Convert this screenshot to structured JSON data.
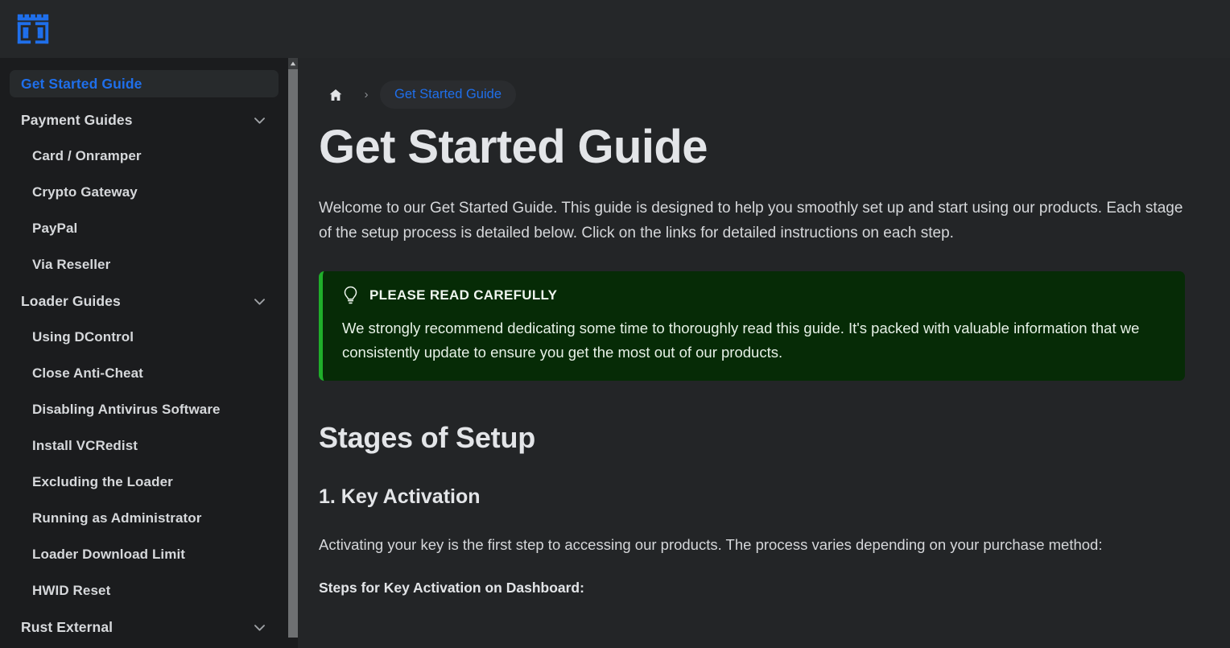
{
  "brand": {
    "logo_icon": "brand-logo-icon",
    "logo_color": "#1f6feb"
  },
  "sidebar": {
    "items": [
      {
        "label": "Get Started Guide",
        "level": "top",
        "active": true,
        "chevron": false
      },
      {
        "label": "Payment Guides",
        "level": "top",
        "active": false,
        "chevron": true
      },
      {
        "label": "Card / Onramper",
        "level": "sub",
        "active": false,
        "chevron": false
      },
      {
        "label": "Crypto Gateway",
        "level": "sub",
        "active": false,
        "chevron": false
      },
      {
        "label": "PayPal",
        "level": "sub",
        "active": false,
        "chevron": false
      },
      {
        "label": "Via Reseller",
        "level": "sub",
        "active": false,
        "chevron": false
      },
      {
        "label": "Loader Guides",
        "level": "top",
        "active": false,
        "chevron": true
      },
      {
        "label": "Using DControl",
        "level": "sub",
        "active": false,
        "chevron": false
      },
      {
        "label": "Close Anti-Cheat",
        "level": "sub",
        "active": false,
        "chevron": false
      },
      {
        "label": "Disabling Antivirus Software",
        "level": "sub",
        "active": false,
        "chevron": false
      },
      {
        "label": "Install VCRedist",
        "level": "sub",
        "active": false,
        "chevron": false
      },
      {
        "label": "Excluding the Loader",
        "level": "sub",
        "active": false,
        "chevron": false
      },
      {
        "label": "Running as Administrator",
        "level": "sub",
        "active": false,
        "chevron": false
      },
      {
        "label": "Loader Download Limit",
        "level": "sub",
        "active": false,
        "chevron": false
      },
      {
        "label": "HWID Reset",
        "level": "sub",
        "active": false,
        "chevron": false
      },
      {
        "label": "Rust External",
        "level": "top",
        "active": false,
        "chevron": true
      }
    ],
    "scrollbar": {
      "up_arrow_icon": "scroll-up-arrow-icon"
    }
  },
  "breadcrumb": {
    "home_icon": "home-icon",
    "separator": "›",
    "current": "Get Started Guide"
  },
  "main": {
    "title": "Get Started Guide",
    "intro": "Welcome to our Get Started Guide. This guide is designed to help you smoothly set up and start using our products. Each stage of the setup process is detailed below. Click on the links for detailed instructions on each step.",
    "callout": {
      "icon": "lightbulb-icon",
      "heading": "PLEASE READ CAREFULLY",
      "body": "We strongly recommend dedicating some time to thoroughly read this guide. It's packed with valuable information that we consistently update to ensure you get the most out of our products.",
      "accent_color": "#1fae2a",
      "background_color": "#062b06"
    },
    "section_title": "Stages of Setup",
    "stage_1": {
      "heading": "1. Key Activation",
      "paragraph": "Activating your key is the first step to accessing our products. The process varies depending on your purchase method:",
      "steps_label": "Steps for Key Activation on Dashboard:"
    }
  },
  "colors": {
    "accent": "#1f6feb",
    "topbar_bg": "#252729",
    "sidebar_bg": "#1b1c1e",
    "content_bg": "#232527"
  }
}
